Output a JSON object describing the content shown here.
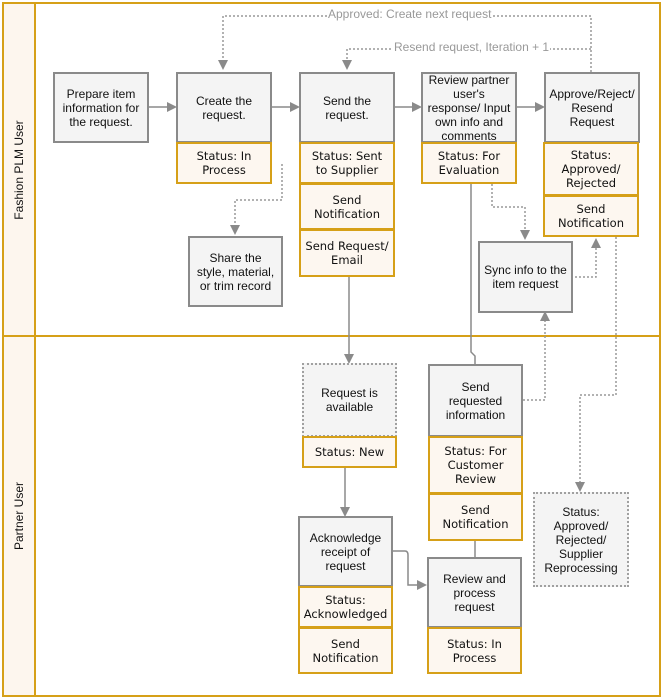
{
  "lanes": {
    "top": "Fashion PLM User",
    "bottom": "Partner User"
  },
  "edge_labels": {
    "approved": "Approved: Create next request",
    "resend": "Resend request, Iteration + 1"
  },
  "nodes": {
    "prepare": "Prepare item information for the request.",
    "create": "Create the request.",
    "create_status": "Status: In Process",
    "send": "Send the request.",
    "send_status": "Status: Sent to Supplier",
    "send_notification": "Send Notification",
    "send_email": "Send Request/ Email",
    "review": "Review partner user's response/ Input own info and comments",
    "review_status": "Status: For Evaluation",
    "approve": "Approve/Reject/ Resend Request",
    "approve_status": "Status: Approved/ Rejected",
    "approve_notification": "Send Notification",
    "share": "Share the style, material, or trim record",
    "sync": "Sync info to the item request",
    "available": "Request is available",
    "available_status": "Status: New",
    "send_info": "Send requested information",
    "send_info_status": "Status: For Customer Review",
    "send_info_notification": "Send Notification",
    "final_status": "Status: Approved/ Rejected/ Supplier Reprocessing",
    "acknowledge": "Acknowledge receipt of request",
    "acknowledge_status": "Status: Acknowledged",
    "acknowledge_notification": "Send Notification",
    "process": "Review and process request",
    "process_status": "Status: In Process"
  },
  "colors": {
    "lane_border": "#d6a018",
    "lane_header_bg": "#fdf6ee",
    "process_fill": "#f4f4f4",
    "process_border": "#8a8a8a",
    "status_fill": "#fdf7f0",
    "connector": "#8a8a8a"
  }
}
